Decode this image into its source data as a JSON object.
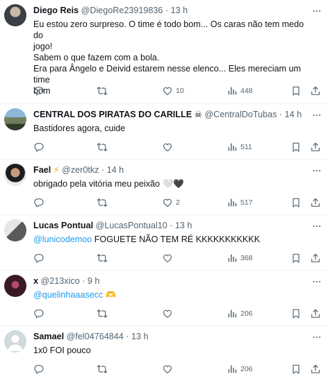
{
  "tweets": [
    {
      "name": "Diego Reis",
      "handle": "@DiegoRe23919836",
      "time": "13 h",
      "lines": [
        "Eu estou zero surpreso. O time é todo bom... Os caras não tem medo do",
        "jogo!",
        "Sabem o que fazem com a bola.",
        "Era para Ângelo e Deivid estarem nesse elenco... Eles mereciam um time",
        "bom"
      ],
      "likes": "10",
      "views": "448"
    },
    {
      "name": "CENTRAL DOS PIRATAS DO CARILLE",
      "name_emoji": "☠",
      "handle": "@CentralDoTubas",
      "time": "14 h",
      "lines": [
        "Bastidores agora, cuide"
      ],
      "likes": "",
      "views": "511"
    },
    {
      "name": "Fael",
      "name_emoji": "⚡",
      "handle": "@zer0tkz",
      "time": "14 h",
      "lines": [
        "obrigado pela vitória meu peixão 🤍🖤"
      ],
      "likes": "2",
      "views": "517"
    },
    {
      "name": "Lucas Pontual",
      "handle": "@LucasPontual10",
      "time": "13 h",
      "mention": "@lunicodemoo",
      "text": " FOGUETE NÃO TEM RÉ KKKKKKKKKKK",
      "likes": "",
      "views": "368"
    },
    {
      "name": "x",
      "handle": "@213xico",
      "time": "9 h",
      "mention": "@quelinhaaasecc",
      "text": " 🫶",
      "likes": "",
      "views": "206"
    },
    {
      "name": "Samael",
      "handle": "@fel04764844",
      "time": "13 h",
      "lines": [
        "1x0 FOI pouco"
      ],
      "likes": "",
      "views": "206"
    }
  ],
  "colors": {
    "text": "#0f1419",
    "secondary": "#536471",
    "link": "#1d9bf0",
    "divider": "#eff3f4"
  },
  "icons": [
    "reply-icon",
    "retweet-icon",
    "like-icon",
    "views-icon",
    "bookmark-icon",
    "share-icon",
    "more-icon"
  ]
}
